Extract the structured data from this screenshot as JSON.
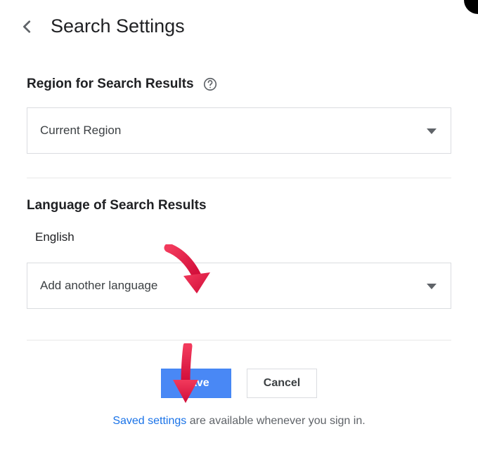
{
  "header": {
    "title": "Search Settings"
  },
  "region": {
    "heading": "Region for Search Results",
    "selected": "Current Region"
  },
  "language": {
    "heading": "Language of Search Results",
    "current": "English",
    "add_placeholder": "Add another language"
  },
  "buttons": {
    "save": "Save",
    "cancel": "Cancel"
  },
  "footer": {
    "link": "Saved settings",
    "rest": " are available whenever you sign in."
  }
}
